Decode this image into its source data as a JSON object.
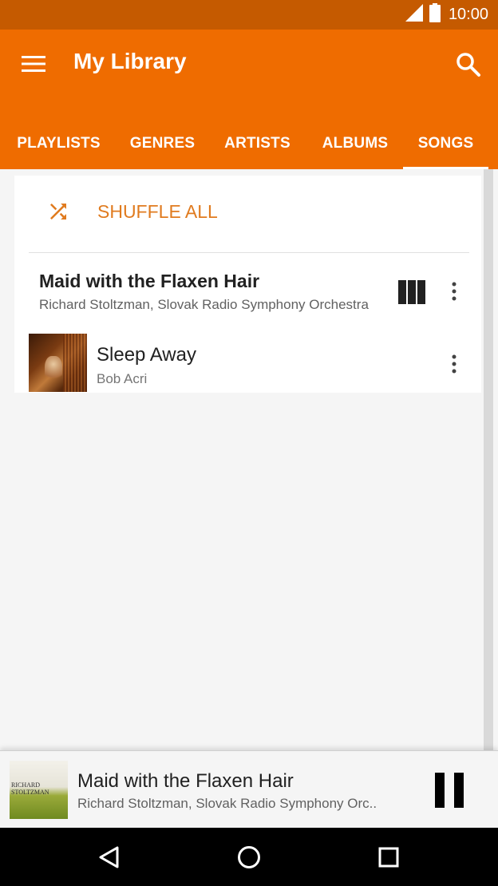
{
  "status_bar": {
    "time": "10:00"
  },
  "app_bar": {
    "title": "My Library",
    "color": "#ef6c00",
    "status_color": "#c55a00"
  },
  "tabs": [
    {
      "label": "PLAYLISTS",
      "selected": false
    },
    {
      "label": "GENRES",
      "selected": false
    },
    {
      "label": "ARTISTS",
      "selected": false
    },
    {
      "label": "ALBUMS",
      "selected": false
    },
    {
      "label": "SONGS",
      "selected": true
    }
  ],
  "shuffle": {
    "label": "SHUFFLE ALL",
    "icon": "shuffle-icon",
    "accent": "#e07b1f"
  },
  "songs": [
    {
      "title": "Maid with the Flaxen Hair",
      "artist": "Richard Stoltzman, Slovak Radio Symphony Orchestra",
      "playing": true,
      "indicator_icon": "equalizer-icon"
    },
    {
      "title": "Sleep Away",
      "artist": "Bob Acri",
      "playing": false
    }
  ],
  "now_playing": {
    "title": "Maid with the Flaxen Hair",
    "artist": "Richard Stoltzman, Slovak Radio Symphony Orc..",
    "art_text_name": "RICHARD STOLTZMAN",
    "control_icon": "pause-icon"
  },
  "nav_bar": {
    "icons": [
      "back-icon",
      "home-icon",
      "recents-icon"
    ]
  }
}
